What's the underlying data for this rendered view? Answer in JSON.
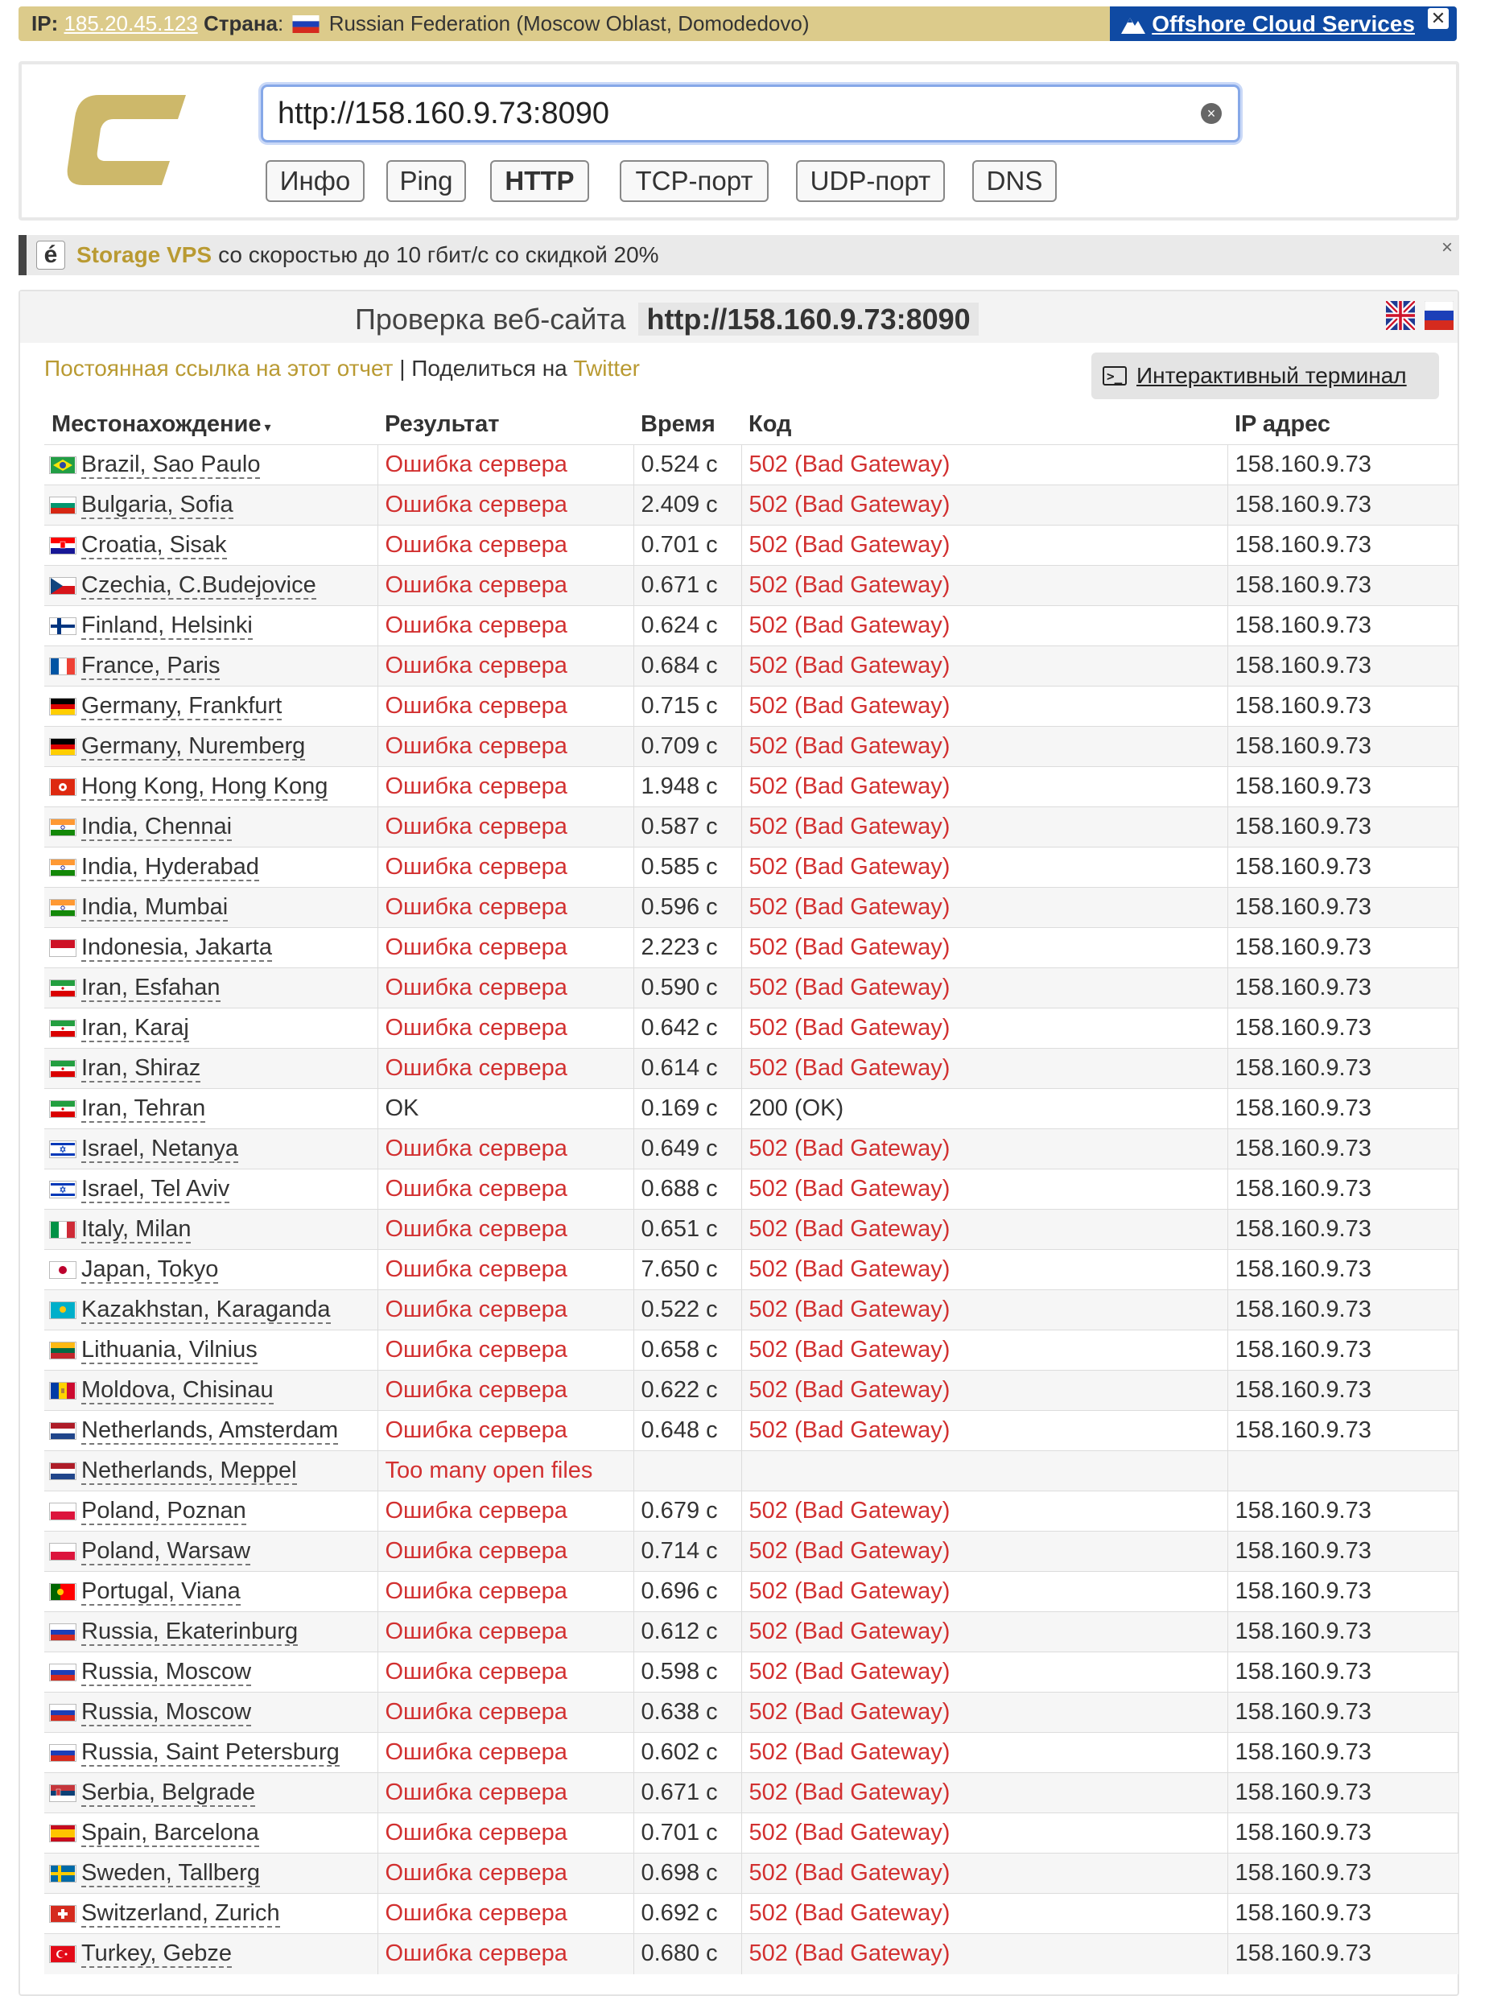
{
  "ipbar": {
    "ip_label": "IP:",
    "ip": "185.20.45.123",
    "country_label": "Страна",
    "country": "Russian Federation (Moscow Oblast, Domodedovo)",
    "ad_text": "Offshore Cloud Services",
    "close": "✕"
  },
  "search": {
    "url": "http://158.160.9.73:8090"
  },
  "tools": [
    "Инфо",
    "Ping",
    "HTTP",
    "TCP-порт",
    "UDP-порт",
    "DNS"
  ],
  "promo": {
    "icon": "é",
    "brand": "Storage VPS",
    "text": "со скоростью до 10 гбит/с со скидкой 20%",
    "close": "×"
  },
  "main": {
    "title": "Проверка веб-сайта",
    "title_url": "http://158.160.9.73:8090",
    "permalink": "Постоянная ссылка на этот отчет",
    "separator": " | ",
    "share": "Поделиться на",
    "twitter": "Twitter",
    "terminal": "Интерактивный терминал"
  },
  "table": {
    "headers": [
      "Местонахождение",
      "Результат",
      "Время",
      "Код",
      "IP адрес"
    ],
    "rows": [
      {
        "location": "Brazil, Sao Paulo",
        "flag": "br",
        "result": "Ошибка сервера",
        "time": "0.524 с",
        "code": "502 (Bad Gateway)",
        "ip": "158.160.9.73"
      },
      {
        "location": "Bulgaria, Sofia",
        "flag": "bg",
        "result": "Ошибка сервера",
        "time": "2.409 с",
        "code": "502 (Bad Gateway)",
        "ip": "158.160.9.73"
      },
      {
        "location": "Croatia, Sisak",
        "flag": "hr",
        "result": "Ошибка сервера",
        "time": "0.701 с",
        "code": "502 (Bad Gateway)",
        "ip": "158.160.9.73"
      },
      {
        "location": "Czechia, C.Budejovice",
        "flag": "cz",
        "result": "Ошибка сервера",
        "time": "0.671 с",
        "code": "502 (Bad Gateway)",
        "ip": "158.160.9.73"
      },
      {
        "location": "Finland, Helsinki",
        "flag": "fi",
        "result": "Ошибка сервера",
        "time": "0.624 с",
        "code": "502 (Bad Gateway)",
        "ip": "158.160.9.73"
      },
      {
        "location": "France, Paris",
        "flag": "fr",
        "result": "Ошибка сервера",
        "time": "0.684 с",
        "code": "502 (Bad Gateway)",
        "ip": "158.160.9.73"
      },
      {
        "location": "Germany, Frankfurt",
        "flag": "de",
        "result": "Ошибка сервера",
        "time": "0.715 с",
        "code": "502 (Bad Gateway)",
        "ip": "158.160.9.73"
      },
      {
        "location": "Germany, Nuremberg",
        "flag": "de",
        "result": "Ошибка сервера",
        "time": "0.709 с",
        "code": "502 (Bad Gateway)",
        "ip": "158.160.9.73"
      },
      {
        "location": "Hong Kong, Hong Kong",
        "flag": "hk",
        "result": "Ошибка сервера",
        "time": "1.948 с",
        "code": "502 (Bad Gateway)",
        "ip": "158.160.9.73"
      },
      {
        "location": "India, Chennai",
        "flag": "in",
        "result": "Ошибка сервера",
        "time": "0.587 с",
        "code": "502 (Bad Gateway)",
        "ip": "158.160.9.73"
      },
      {
        "location": "India, Hyderabad",
        "flag": "in",
        "result": "Ошибка сервера",
        "time": "0.585 с",
        "code": "502 (Bad Gateway)",
        "ip": "158.160.9.73"
      },
      {
        "location": "India, Mumbai",
        "flag": "in",
        "result": "Ошибка сервера",
        "time": "0.596 с",
        "code": "502 (Bad Gateway)",
        "ip": "158.160.9.73"
      },
      {
        "location": "Indonesia, Jakarta",
        "flag": "id",
        "result": "Ошибка сервера",
        "time": "2.223 с",
        "code": "502 (Bad Gateway)",
        "ip": "158.160.9.73"
      },
      {
        "location": "Iran, Esfahan",
        "flag": "ir",
        "result": "Ошибка сервера",
        "time": "0.590 с",
        "code": "502 (Bad Gateway)",
        "ip": "158.160.9.73"
      },
      {
        "location": "Iran, Karaj",
        "flag": "ir",
        "result": "Ошибка сервера",
        "time": "0.642 с",
        "code": "502 (Bad Gateway)",
        "ip": "158.160.9.73"
      },
      {
        "location": "Iran, Shiraz",
        "flag": "ir",
        "result": "Ошибка сервера",
        "time": "0.614 с",
        "code": "502 (Bad Gateway)",
        "ip": "158.160.9.73"
      },
      {
        "location": "Iran, Tehran",
        "flag": "ir",
        "result": "OK",
        "time": "0.169 с",
        "code": "200 (OK)",
        "ip": "158.160.9.73"
      },
      {
        "location": "Israel, Netanya",
        "flag": "il",
        "result": "Ошибка сервера",
        "time": "0.649 с",
        "code": "502 (Bad Gateway)",
        "ip": "158.160.9.73"
      },
      {
        "location": "Israel, Tel Aviv",
        "flag": "il",
        "result": "Ошибка сервера",
        "time": "0.688 с",
        "code": "502 (Bad Gateway)",
        "ip": "158.160.9.73"
      },
      {
        "location": "Italy, Milan",
        "flag": "it",
        "result": "Ошибка сервера",
        "time": "0.651 с",
        "code": "502 (Bad Gateway)",
        "ip": "158.160.9.73"
      },
      {
        "location": "Japan, Tokyo",
        "flag": "jp",
        "result": "Ошибка сервера",
        "time": "7.650 с",
        "code": "502 (Bad Gateway)",
        "ip": "158.160.9.73"
      },
      {
        "location": "Kazakhstan, Karaganda",
        "flag": "kz",
        "result": "Ошибка сервера",
        "time": "0.522 с",
        "code": "502 (Bad Gateway)",
        "ip": "158.160.9.73"
      },
      {
        "location": "Lithuania, Vilnius",
        "flag": "lt",
        "result": "Ошибка сервера",
        "time": "0.658 с",
        "code": "502 (Bad Gateway)",
        "ip": "158.160.9.73"
      },
      {
        "location": "Moldova, Chisinau",
        "flag": "md",
        "result": "Ошибка сервера",
        "time": "0.622 с",
        "code": "502 (Bad Gateway)",
        "ip": "158.160.9.73"
      },
      {
        "location": "Netherlands, Amsterdam",
        "flag": "nl",
        "result": "Ошибка сервера",
        "time": "0.648 с",
        "code": "502 (Bad Gateway)",
        "ip": "158.160.9.73"
      },
      {
        "location": "Netherlands, Meppel",
        "flag": "nl",
        "result": "Too many open files",
        "time": "",
        "code": "",
        "ip": ""
      },
      {
        "location": "Poland, Poznan",
        "flag": "pl",
        "result": "Ошибка сервера",
        "time": "0.679 с",
        "code": "502 (Bad Gateway)",
        "ip": "158.160.9.73"
      },
      {
        "location": "Poland, Warsaw",
        "flag": "pl",
        "result": "Ошибка сервера",
        "time": "0.714 с",
        "code": "502 (Bad Gateway)",
        "ip": "158.160.9.73"
      },
      {
        "location": "Portugal, Viana",
        "flag": "pt",
        "result": "Ошибка сервера",
        "time": "0.696 с",
        "code": "502 (Bad Gateway)",
        "ip": "158.160.9.73"
      },
      {
        "location": "Russia, Ekaterinburg",
        "flag": "ru",
        "result": "Ошибка сервера",
        "time": "0.612 с",
        "code": "502 (Bad Gateway)",
        "ip": "158.160.9.73"
      },
      {
        "location": "Russia, Moscow",
        "flag": "ru",
        "result": "Ошибка сервера",
        "time": "0.598 с",
        "code": "502 (Bad Gateway)",
        "ip": "158.160.9.73"
      },
      {
        "location": "Russia, Moscow",
        "flag": "ru",
        "result": "Ошибка сервера",
        "time": "0.638 с",
        "code": "502 (Bad Gateway)",
        "ip": "158.160.9.73"
      },
      {
        "location": "Russia, Saint Petersburg",
        "flag": "ru",
        "result": "Ошибка сервера",
        "time": "0.602 с",
        "code": "502 (Bad Gateway)",
        "ip": "158.160.9.73"
      },
      {
        "location": "Serbia, Belgrade",
        "flag": "rs",
        "result": "Ошибка сервера",
        "time": "0.671 с",
        "code": "502 (Bad Gateway)",
        "ip": "158.160.9.73"
      },
      {
        "location": "Spain, Barcelona",
        "flag": "es",
        "result": "Ошибка сервера",
        "time": "0.701 с",
        "code": "502 (Bad Gateway)",
        "ip": "158.160.9.73"
      },
      {
        "location": "Sweden, Tallberg",
        "flag": "se",
        "result": "Ошибка сервера",
        "time": "0.698 с",
        "code": "502 (Bad Gateway)",
        "ip": "158.160.9.73"
      },
      {
        "location": "Switzerland, Zurich",
        "flag": "ch",
        "result": "Ошибка сервера",
        "time": "0.692 с",
        "code": "502 (Bad Gateway)",
        "ip": "158.160.9.73"
      },
      {
        "location": "Turkey, Gebze",
        "flag": "tr",
        "result": "Ошибка сервера",
        "time": "0.680 с",
        "code": "502 (Bad Gateway)",
        "ip": "158.160.9.73"
      }
    ]
  },
  "colors": {
    "accent_gold": "#b99a32",
    "error_red": "#d23030",
    "ipbar_bg": "#dccb8b",
    "ad_blue": "#0f4aa3"
  }
}
